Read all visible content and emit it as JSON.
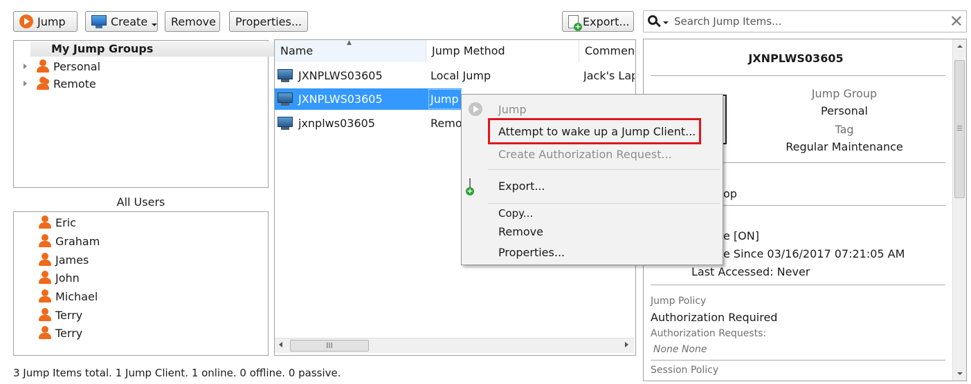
{
  "toolbar": {
    "jump": "Jump",
    "create": "Create",
    "remove": "Remove",
    "properties": "Properties...",
    "export": "Export..."
  },
  "search": {
    "placeholder": "Search Jump Items..."
  },
  "groups": {
    "header": "My Jump Groups",
    "items": [
      {
        "label": "Personal"
      },
      {
        "label": "Remote"
      }
    ]
  },
  "users": {
    "header": "All Users",
    "items": [
      "Eric",
      "Graham",
      "James",
      "John",
      "Michael",
      "Terry",
      "Terry"
    ]
  },
  "table": {
    "columns": [
      "Name",
      "Jump Method",
      "Commen"
    ],
    "rows": [
      {
        "name": "JXNPLWS03605",
        "method": "Local Jump",
        "comment": "Jack's Lap"
      },
      {
        "name": "JXNPLWS03605",
        "method": "Jump",
        "comment": "",
        "selected": true
      },
      {
        "name": "jxnplws03605",
        "method": "Remo",
        "comment": ""
      }
    ],
    "hscroll_thumb": "III"
  },
  "context_menu": {
    "items": {
      "jump": "Jump",
      "wake": "Attempt to wake up a Jump Client...",
      "auth": "Create Authorization Request...",
      "export": "Export...",
      "copy": "Copy...",
      "remove": "Remove",
      "properties": "Properties..."
    },
    "highlight_color": "#e2141b"
  },
  "detail": {
    "title": "JXNPLWS03605",
    "jump_group_label": "Jump Group",
    "jump_group_value": "Personal",
    "tag_label": "Tag",
    "tag_value": "Regular Maintenance",
    "partial_op": "op",
    "status_on": "e [ON]",
    "since": "e Since 03/16/2017 07:21:05 AM",
    "last_accessed": "Last Accessed: Never",
    "jump_policy_label": "Jump Policy",
    "jump_policy_value": "Authorization Required",
    "auth_requests_label": "Authorization Requests:",
    "auth_requests_value": "None  None",
    "session_policy_label": "Session Policy"
  },
  "status_bar": "3 Jump Items total.  1 Jump Client.  1 online.  0 offline.  0 passive.",
  "colors": {
    "accent": "#ef6a1b",
    "selection": "#3399ff"
  }
}
